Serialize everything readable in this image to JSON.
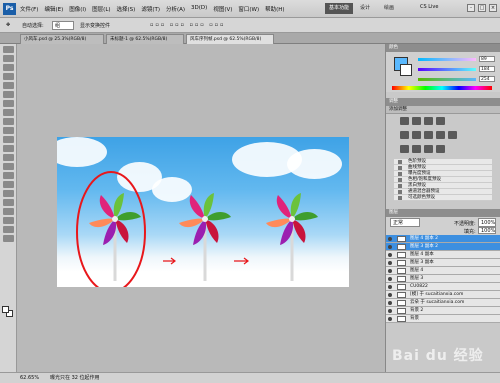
{
  "menubar": {
    "logo": "Ps",
    "items": [
      "文件(F)",
      "编辑(E)",
      "图像(I)",
      "图层(L)",
      "选择(S)",
      "滤镜(T)",
      "分析(A)",
      "3D(D)",
      "视图(V)",
      "窗口(W)",
      "帮助(H)"
    ],
    "zoom": "62.5",
    "workspaces": [
      "基本功能",
      "设计",
      "绘画"
    ],
    "cs_live": "CS Live",
    "window_controls": [
      "-",
      "□",
      "×"
    ]
  },
  "options": {
    "auto_select_label": "自动选择:",
    "auto_select_value": "组",
    "transform_label": "显示变换控件"
  },
  "tabs": [
    {
      "label": "小风车.psd @ 25.3%(RGB/8)",
      "active": false
    },
    {
      "label": "未标题-1 @ 62.5%(RGB/8)",
      "active": false
    },
    {
      "label": "风车序列帧.psd @ 62.5%(RGB/8)",
      "active": true
    }
  ],
  "statusbar": {
    "zoom": "62.65%",
    "info": "曝光只在 32 位起作用"
  },
  "colors": {
    "accent": "#3d8fe0",
    "selection_ring": "#e8171b",
    "arrow": "#e8171b",
    "canvas_sky": "#3ea2e6"
  },
  "color_panel": {
    "tab": "颜色",
    "r": "89",
    "g": "184",
    "b": "254"
  },
  "adjust_panel": {
    "tab": "调整",
    "title": "添加调整",
    "presets": [
      "色阶预设",
      "曲线预设",
      "曝光度预设",
      "色相/饱和度预设",
      "黑白预设",
      "通道混合器预设",
      "可选颜色预设"
    ]
  },
  "layers_panel": {
    "tab": "图层",
    "mode": "正常",
    "opacity_label": "不透明度:",
    "opacity": "100%",
    "fill_label": "填充:",
    "fill": "100%",
    "layers": [
      {
        "name": "图层 4 副本 2",
        "selected": true
      },
      {
        "name": "图层 3 副本 2",
        "selected": true
      },
      {
        "name": "图层 4 副本",
        "selected": false
      },
      {
        "name": "图层 3 副本",
        "selected": false
      },
      {
        "name": "图层 4",
        "selected": false
      },
      {
        "name": "图层 3",
        "selected": false
      },
      {
        "name": "CU0822",
        "selected": false
      },
      {
        "name": "[模] 于 sucaitianxia.com",
        "selected": false
      },
      {
        "name": "云朵 于 sucaitianxia.com",
        "selected": false
      },
      {
        "name": "背景 2",
        "selected": false
      },
      {
        "name": "背景",
        "selected": false
      }
    ]
  },
  "watermark": "Bai du 经验"
}
